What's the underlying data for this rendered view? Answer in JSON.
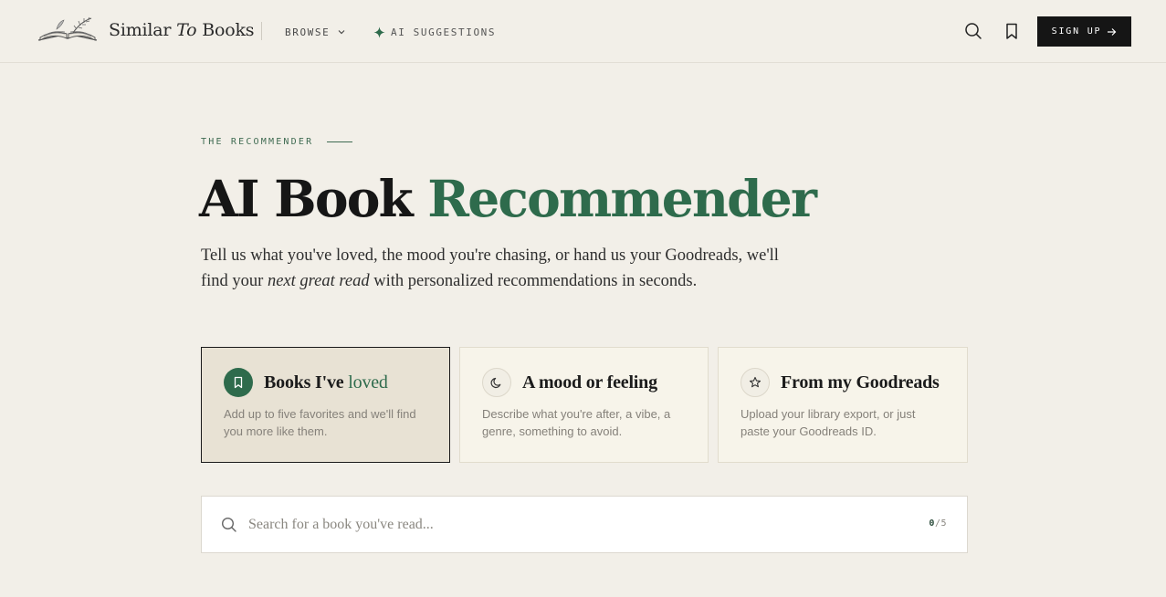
{
  "header": {
    "logo_text_1": "Similar",
    "logo_text_2": "To",
    "logo_text_3": "Books",
    "nav_browse": "BROWSE",
    "nav_ai": "AI SUGGESTIONS",
    "signup": "SIGN UP"
  },
  "hero": {
    "eyebrow": "THE RECOMMENDER",
    "title_1": "AI Book",
    "title_2": "Recommender",
    "subtitle_1": "Tell us what you've loved, the mood you're chasing, or hand us your Goodreads, we'll find your",
    "subtitle_em": "next great read",
    "subtitle_2": "with personalized recommendations in seconds."
  },
  "cards": [
    {
      "title_a": "Books I've",
      "title_b": "loved",
      "desc": "Add up to five favorites and we'll find you more like them.",
      "icon": "bookmark-icon",
      "active": true
    },
    {
      "title_a": "A mood or feeling",
      "title_b": "",
      "desc": "Describe what you're after, a vibe, a genre, something to avoid.",
      "icon": "moon-icon",
      "active": false
    },
    {
      "title_a": "From my Goodreads",
      "title_b": "",
      "desc": "Upload your library export, or just paste your Goodreads ID.",
      "icon": "star-icon",
      "active": false
    }
  ],
  "search": {
    "placeholder": "Search for a book you've read...",
    "count_current": "0",
    "count_sep": "/",
    "count_max": "5"
  },
  "colors": {
    "accent": "#2e6b4c",
    "background": "#f2efe8",
    "signup_bg": "#151515"
  }
}
